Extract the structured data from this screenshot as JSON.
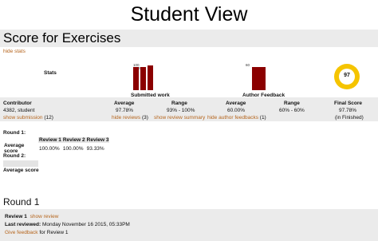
{
  "header": {
    "title": "Student View"
  },
  "score_section": {
    "heading": "Score for Exercises",
    "hide_stats": "hide stats"
  },
  "stats": {
    "label": "Stats",
    "submitted_work": {
      "label": "Submitted work",
      "mini_values": [
        "100",
        "93.33"
      ]
    },
    "author_feedback": {
      "label": "Author Feedback",
      "mini_value": "60"
    },
    "final_donut": {
      "value": "97"
    }
  },
  "summary_table": {
    "headers": {
      "contributor": "Contributor",
      "avg1": "Average",
      "range1": "Range",
      "avg2": "Average",
      "range2": "Range",
      "final": "Final Score"
    },
    "row": {
      "contributor": "4382, student",
      "avg1": "97.78%",
      "range1": "93% - 100%",
      "avg2": "60.00%",
      "range2": "60% - 60%",
      "final": "97.78%"
    },
    "links": {
      "show_submission": "show submission",
      "show_submission_count": "(12)",
      "hide_reviews": "hide reviews",
      "hide_reviews_count": "(3)",
      "show_review_summary": "show review summary",
      "hide_author_feedbacks": "hide author feedbacks",
      "hide_author_feedbacks_count": "(1)",
      "in_finished": "(in Finished)"
    }
  },
  "rounds": {
    "round1_label": "Round 1:",
    "columns": [
      "Review 1",
      "Review 2",
      "Review 3"
    ],
    "avg_label": "Average score",
    "values": [
      "100.00%",
      "100.00%",
      "93.33%"
    ],
    "round2_label": "Round 2:",
    "avg_label2": "Average score"
  },
  "round_detail": {
    "heading": "Round 1",
    "review_label": "Review 1",
    "show_review": "show review",
    "last_reviewed_label": "Last reviewed:",
    "last_reviewed_value": "Monday November 16 2015, 05:33PM",
    "give_feedback": "Give feedback",
    "for_review": "for Review 1"
  },
  "colors": {
    "bar": "#8b0000",
    "donut": "#f5c400",
    "link": "#b5651d",
    "band": "#ebebeb"
  }
}
